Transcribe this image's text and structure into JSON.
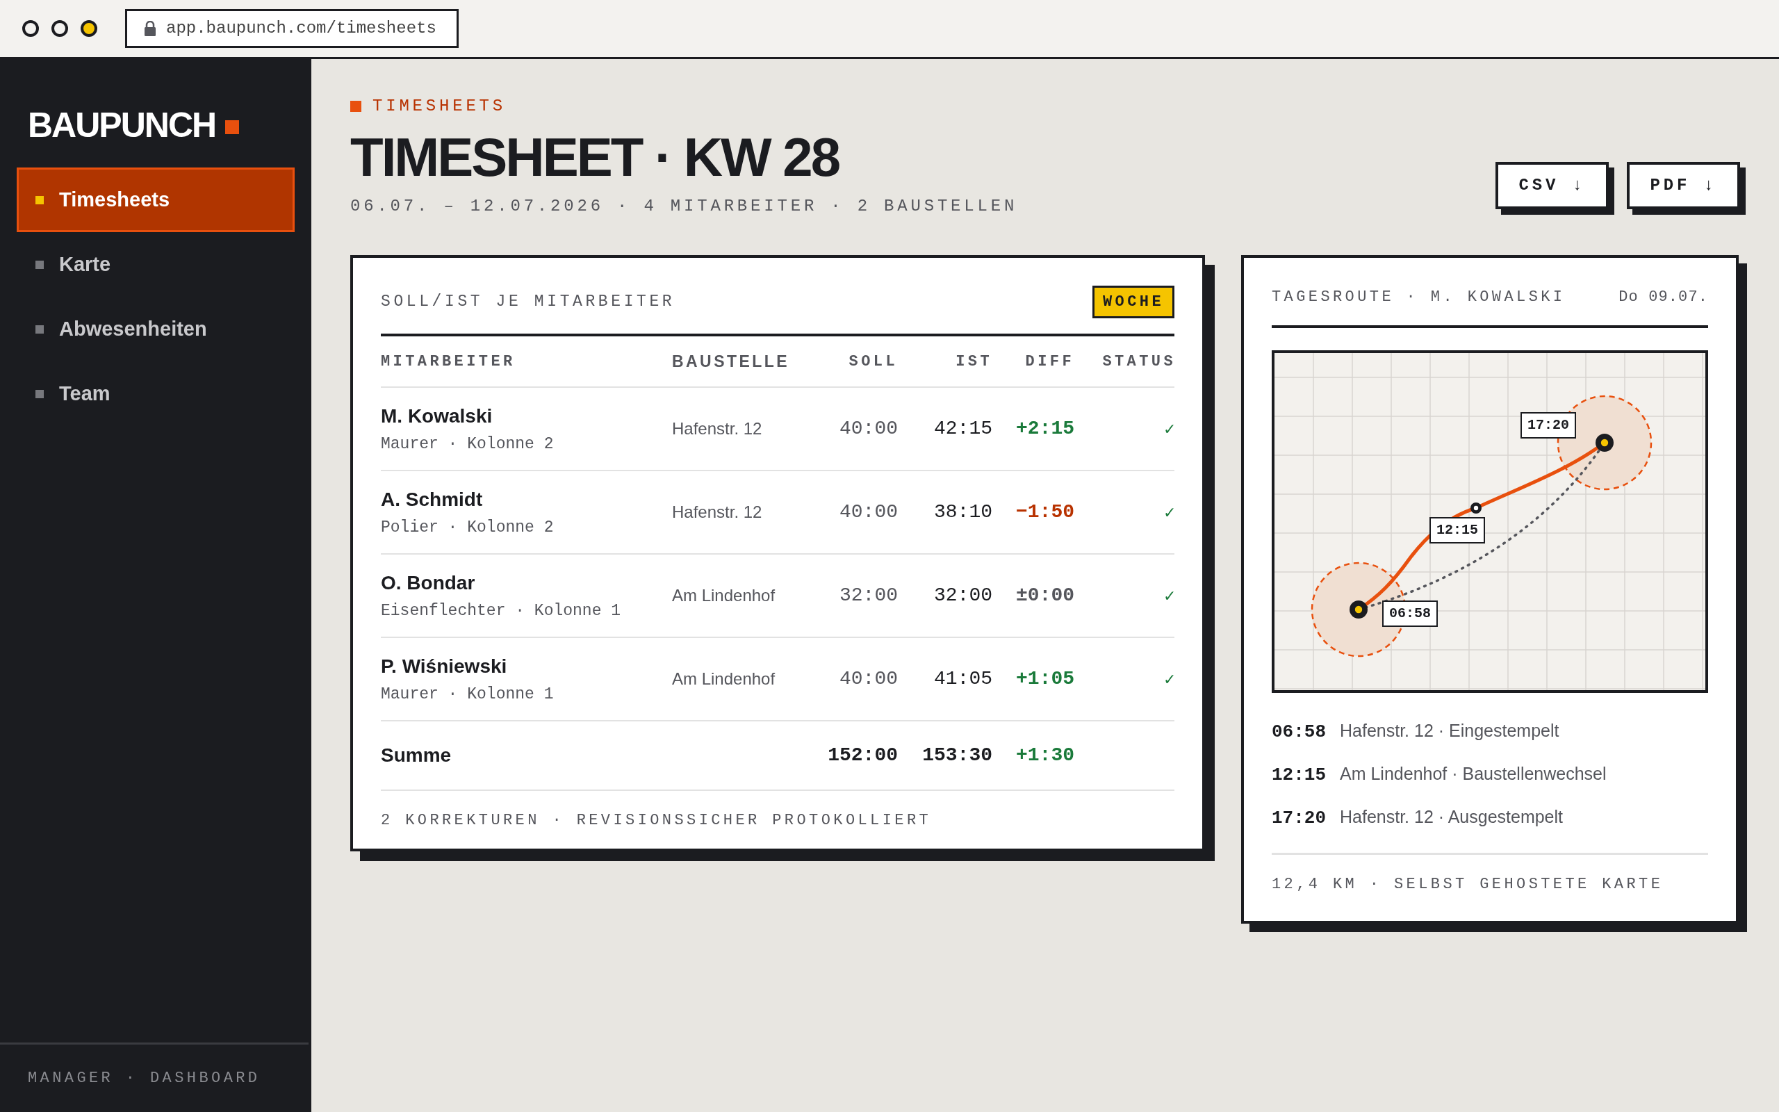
{
  "browser": {
    "url": "app.baupunch.com/timesheets"
  },
  "sidebar": {
    "logo": "BAUPUNCH",
    "nav": [
      {
        "label": "Timesheets",
        "selected": true
      },
      {
        "label": "Karte",
        "selected": false
      },
      {
        "label": "Abwesenheiten",
        "selected": false
      },
      {
        "label": "Team",
        "selected": false
      }
    ],
    "footer": "MANAGER · DASHBOARD"
  },
  "header": {
    "eyebrow": "TIMESHEETS",
    "title": "TIMESHEET · KW 28",
    "subtitle": "06.07. – 12.07.2026 · 4 MITARBEITER · 2 BAUSTELLEN",
    "buttons": [
      "CSV ↓",
      "PDF ↓"
    ]
  },
  "table_card": {
    "title": "SOLL/IST JE MITARBEITER",
    "badge": "WOCHE",
    "columns": [
      "MITARBEITER",
      "BAUSTELLE",
      "SOLL",
      "IST",
      "DIFF",
      "STATUS"
    ],
    "rows": [
      {
        "name": "M. Kowalski",
        "role": "Maurer · Kolonne 2",
        "site": "Hafenstr. 12",
        "soll": "40:00",
        "ist": "42:15",
        "diff": "+2:15",
        "kind": "plus",
        "status": "✓"
      },
      {
        "name": "A. Schmidt",
        "role": "Polier · Kolonne 2",
        "site": "Hafenstr. 12",
        "soll": "40:00",
        "ist": "38:10",
        "diff": "−1:50",
        "kind": "minus",
        "status": "✓"
      },
      {
        "name": "O. Bondar",
        "role": "Eisenflechter · Kolonne 1",
        "site": "Am Lindenhof",
        "soll": "32:00",
        "ist": "32:00",
        "diff": "±0:00",
        "kind": "zero",
        "status": "✓"
      },
      {
        "name": "P. Wiśniewski",
        "role": "Maurer · Kolonne 1",
        "site": "Am Lindenhof",
        "soll": "40:00",
        "ist": "41:05",
        "diff": "+1:05",
        "kind": "plus",
        "status": "✓"
      }
    ],
    "total": {
      "label": "Summe",
      "soll": "152:00",
      "ist": "153:30",
      "diff": "+1:30",
      "kind": "plus"
    },
    "footer": "2 KORREKTUREN · REVISIONSSICHER PROTOKOLLIERT"
  },
  "route_card": {
    "title": "TAGESROUTE · M. KOWALSKI",
    "date": "Do 09.07.",
    "map_labels": [
      "06:58",
      "12:15",
      "17:20"
    ],
    "stops": [
      {
        "time": "06:58",
        "text": "Hafenstr. 12 · Eingestempelt"
      },
      {
        "time": "12:15",
        "text": "Am Lindenhof · Baustellenwechsel"
      },
      {
        "time": "17:20",
        "text": "Hafenstr. 12 · Ausgestempelt"
      }
    ],
    "footer": "12,4 KM · SELBST GEHOSTETE KARTE"
  }
}
